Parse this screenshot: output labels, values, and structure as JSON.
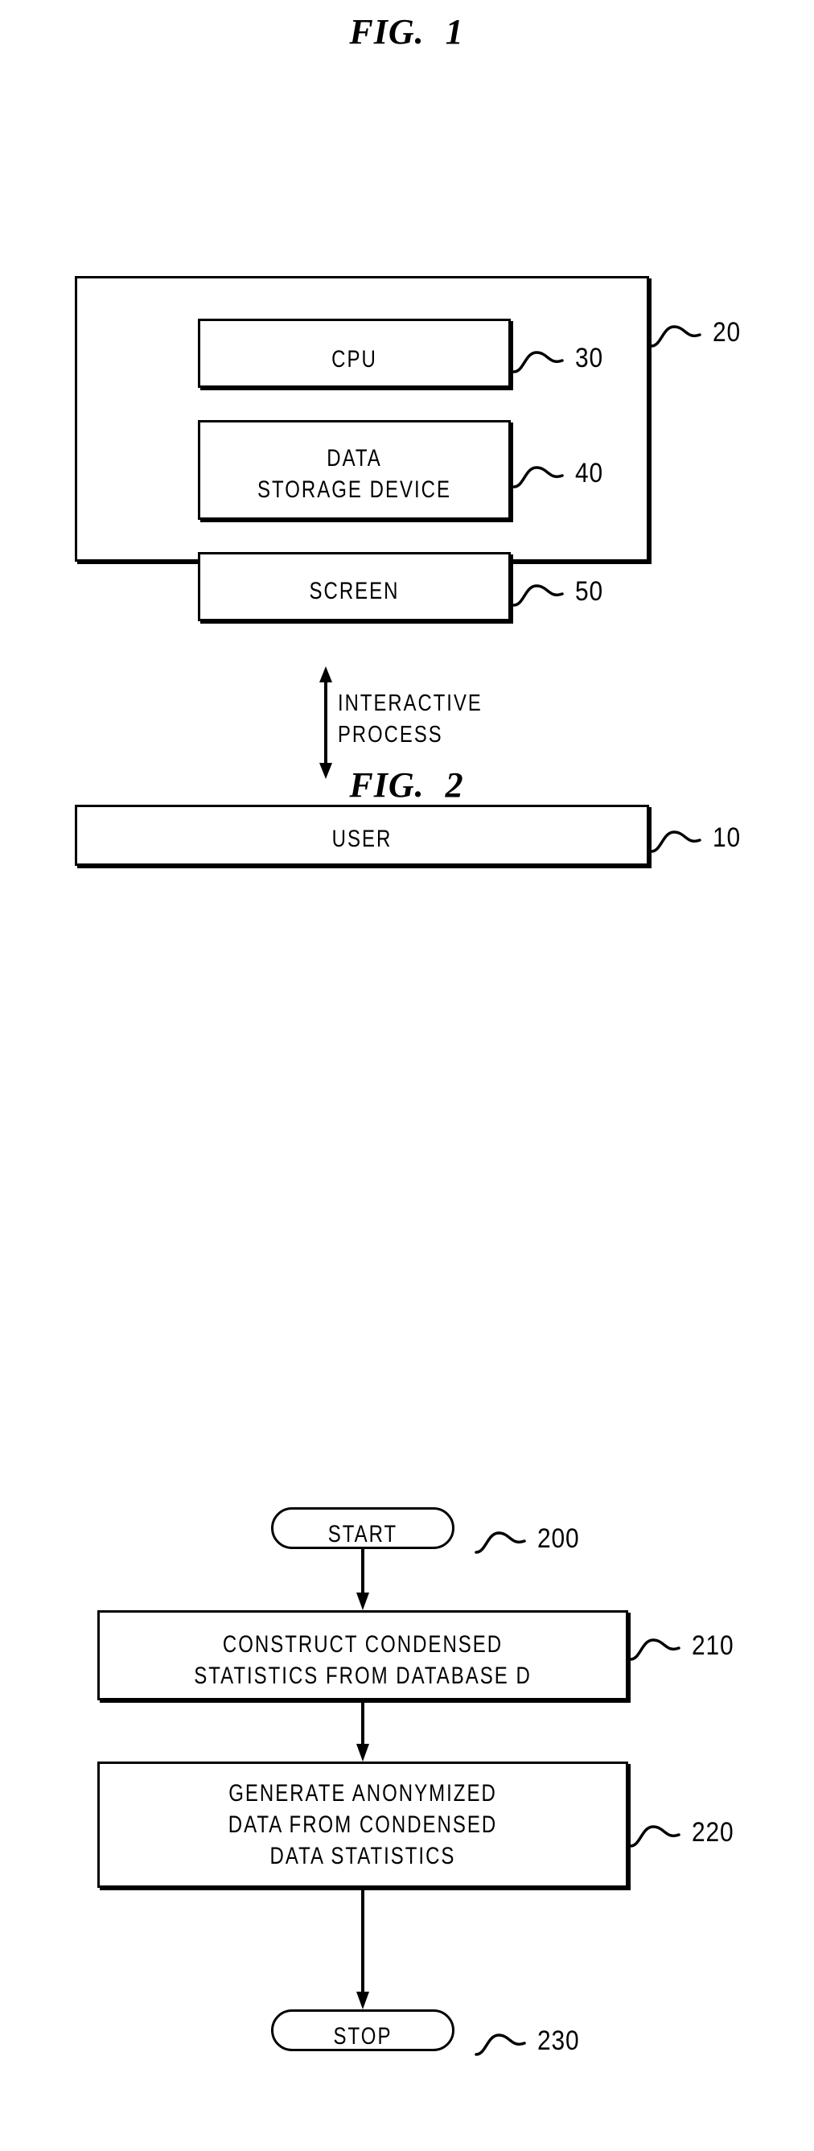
{
  "figure1": {
    "title_word": "FIG.",
    "title_number": "1",
    "system_box": {
      "ref": "20"
    },
    "components": [
      {
        "name": "cpu",
        "label": "CPU",
        "ref": "30"
      },
      {
        "name": "storage",
        "label": "DATA\nSTORAGE DEVICE",
        "ref": "40"
      },
      {
        "name": "screen",
        "label": "SCREEN",
        "ref": "50"
      }
    ],
    "connector_label": "INTERACTIVE\nPROCESS",
    "user_box": {
      "label": "USER",
      "ref": "10"
    }
  },
  "figure2": {
    "title_word": "FIG.",
    "title_number": "2",
    "start": {
      "label": "START",
      "ref": "200"
    },
    "steps": [
      {
        "label": "CONSTRUCT CONDENSED\nSTATISTICS FROM DATABASE D",
        "ref": "210"
      },
      {
        "label": "GENERATE ANONYMIZED\nDATA FROM CONDENSED\nDATA STATISTICS",
        "ref": "220"
      }
    ],
    "stop": {
      "label": "STOP",
      "ref": "230"
    }
  },
  "style": {
    "ink": "#000000",
    "paper": "#ffffff"
  }
}
